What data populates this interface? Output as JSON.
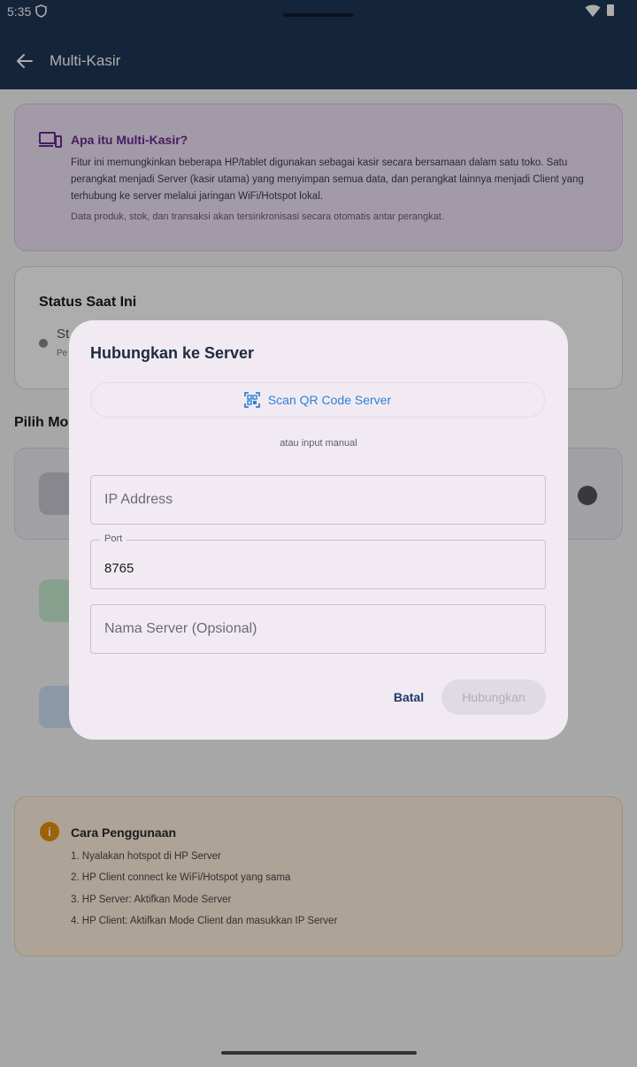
{
  "status_bar": {
    "time": "5:35"
  },
  "app_bar": {
    "title": "Multi-Kasir"
  },
  "info_card": {
    "title": "Apa itu Multi-Kasir?",
    "body": "Fitur ini memungkinkan beberapa HP/tablet digunakan sebagai kasir secara bersamaan dalam satu toko. Satu perangkat menjadi Server (kasir utama) yang menyimpan semua data, dan perangkat lainnya menjadi Client yang terhubung ke server melalui jaringan WiFi/Hotspot lokal.",
    "note": "Data produk, stok, dan transaksi akan tersinkronisasi secara otomatis antar perangkat."
  },
  "status_card": {
    "title": "Status Saat Ini",
    "line1": "St",
    "line2": "Pe"
  },
  "mode_section": {
    "label": "Pilih Mo"
  },
  "guide_card": {
    "title": "Cara Penggunaan",
    "steps": [
      "1. Nyalakan hotspot di HP Server",
      "2. HP Client connect ke WiFi/Hotspot yang sama",
      "3. HP Server: Aktifkan Mode Server",
      "4. HP Client: Aktifkan Mode Client dan masukkan IP Server"
    ]
  },
  "dialog": {
    "title": "Hubungkan ke Server",
    "scan_button": "Scan QR Code Server",
    "or_text": "atau input manual",
    "ip_field": {
      "placeholder": "IP Address",
      "value": ""
    },
    "port_field": {
      "label": "Port",
      "value": "8765"
    },
    "name_field": {
      "placeholder": "Nama Server (Opsional)",
      "value": ""
    },
    "cancel_button": "Batal",
    "connect_button": "Hubungkan"
  },
  "colors": {
    "app_bar": "#1e3657",
    "accent": "#2a83d8",
    "info_title": "#6a2a90",
    "guide_icon": "#e8900c"
  }
}
